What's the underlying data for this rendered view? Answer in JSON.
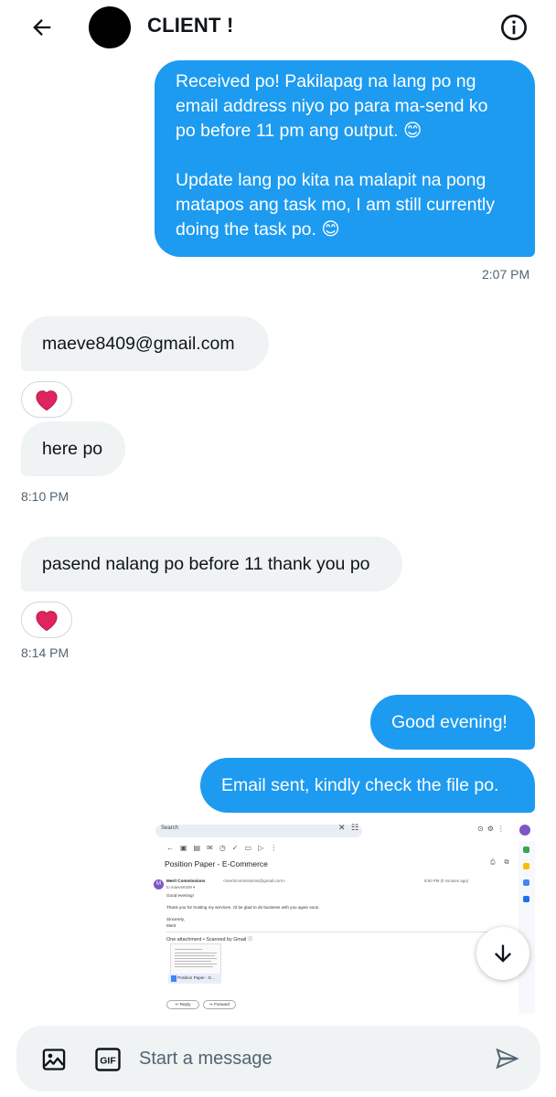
{
  "header": {
    "title": "CLIENT !",
    "back_icon": "arrow-left-icon",
    "info_icon": "info-circle-icon"
  },
  "messages": [
    {
      "direction": "outgoing",
      "paragraphs": [
        "Received po! Pakilapag na lang po ng email address niyo po para ma-send ko po before 11 pm ang output. 😊",
        "Update lang po kita na malapit na pong matapos ang task mo, I am still currently doing the task po. 😊"
      ],
      "line_breaks": [
        [
          "Received po! Pakilapag na lang po ng",
          "email address niyo po para ma-send ko",
          "po before 11 pm ang output. 😊"
        ],
        [
          "Update lang po kita na malapit na pong",
          "matapos ang task mo, I am still currently",
          "doing the task po. 😊"
        ]
      ],
      "time": "2:07 PM"
    },
    {
      "direction": "incoming",
      "text": "maeve8409@gmail.com",
      "reaction": "❤️"
    },
    {
      "direction": "incoming",
      "text": "here po",
      "time": "8:10 PM"
    },
    {
      "direction": "incoming",
      "text": "pasend nalang po before 11 thank you po",
      "reaction": "❤️",
      "time": "8:14 PM"
    },
    {
      "direction": "outgoing",
      "text": "Good evening!"
    },
    {
      "direction": "outgoing",
      "text": "Email sent, kindly check the file po."
    }
  ],
  "attachment": {
    "kind": "email-screenshot",
    "search_text": "Search",
    "subject": "Position Paper - E-Commerce",
    "sender_initial": "M",
    "sender_name": "Merit Commissions",
    "sender_email": "<meritcommissions@gmail.com>",
    "to_line": "to maeve8409 ▾",
    "date": "8:50 PM (0 minutes ago)",
    "body_greeting": "Good evening!",
    "body_text": "Thank you for trusting my services. I'd be glad to do business with you again soon.",
    "signature_1": "Sincerely,",
    "signature_2": "Merit",
    "attachment_label": "One attachment • Scanned by Gmail ⓘ",
    "file_name": "Position Paper - E...",
    "reply_label": "↩ Reply",
    "forward_label": "↪ Forward"
  },
  "composer": {
    "placeholder": "Start a message",
    "media_icon": "image-icon",
    "gif_label": "GIF",
    "send_icon": "send-icon"
  },
  "colors": {
    "outgoing_bubble": "#1d9bf0",
    "incoming_bubble": "#eff3f4",
    "reaction_heart": "#e0245e"
  },
  "scroll_down_icon": "arrow-down-icon"
}
